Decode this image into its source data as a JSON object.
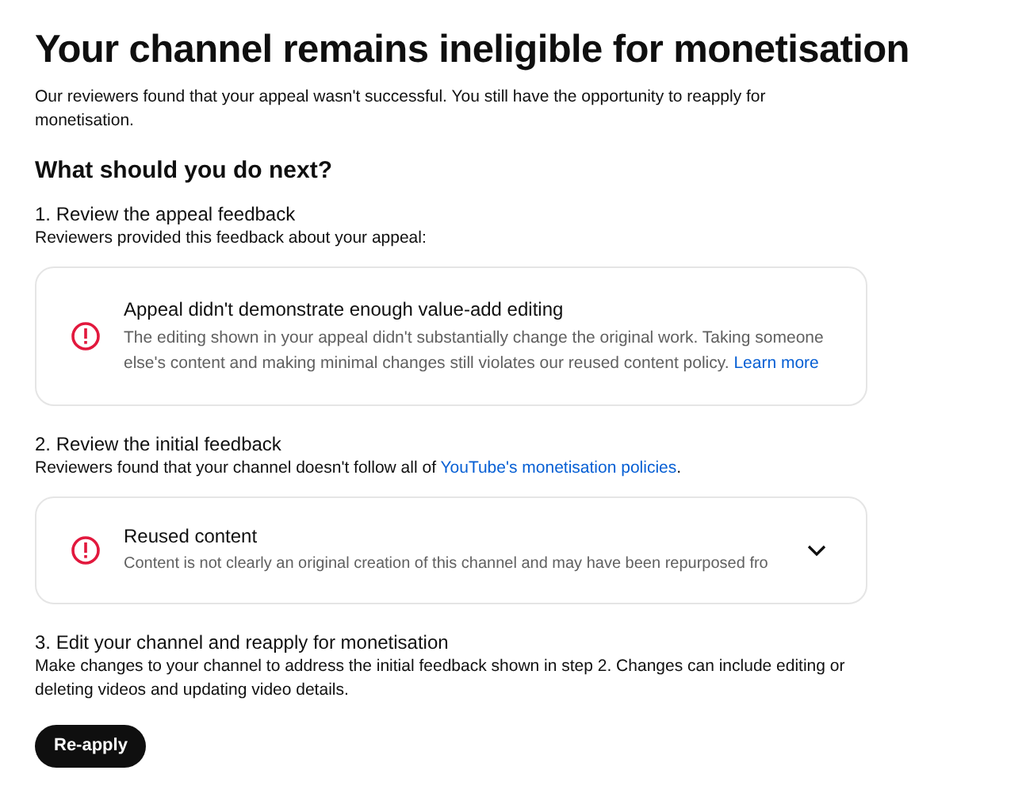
{
  "title": "Your channel remains ineligible for monetisation",
  "intro": "Our reviewers found that your appeal wasn't successful. You still have the opportunity to reapply for monetisation.",
  "next_heading": "What should you do next?",
  "steps": [
    {
      "kind": "feedback",
      "heading": "1. Review the appeal feedback",
      "description": "Reviewers provided this feedback about your appeal:",
      "card": {
        "title": "Appeal didn't demonstrate enough value-add editing",
        "body": "The editing shown in your appeal didn't substantially change the original work. Taking someone else's content and making minimal changes still violates our reused content policy.",
        "link": "Learn more"
      }
    },
    {
      "kind": "feedback",
      "heading": "2. Review the initial feedback",
      "description": "Reviewers found that your channel doesn't follow all of",
      "description_link": "YouTube's monetisation policies",
      "description_end": ".",
      "card": {
        "title": "Reused content",
        "body": "Content is not clearly an original creation of this channel and may have been repurposed fro",
        "expanded": false
      }
    },
    {
      "kind": "action",
      "heading": "3. Edit your channel and reapply for monetisation",
      "description": "Make changes to your channel to address the initial feedback shown in step 2. Changes can include editing or deleting videos and updating video details.",
      "button": "Re-apply"
    }
  ]
}
